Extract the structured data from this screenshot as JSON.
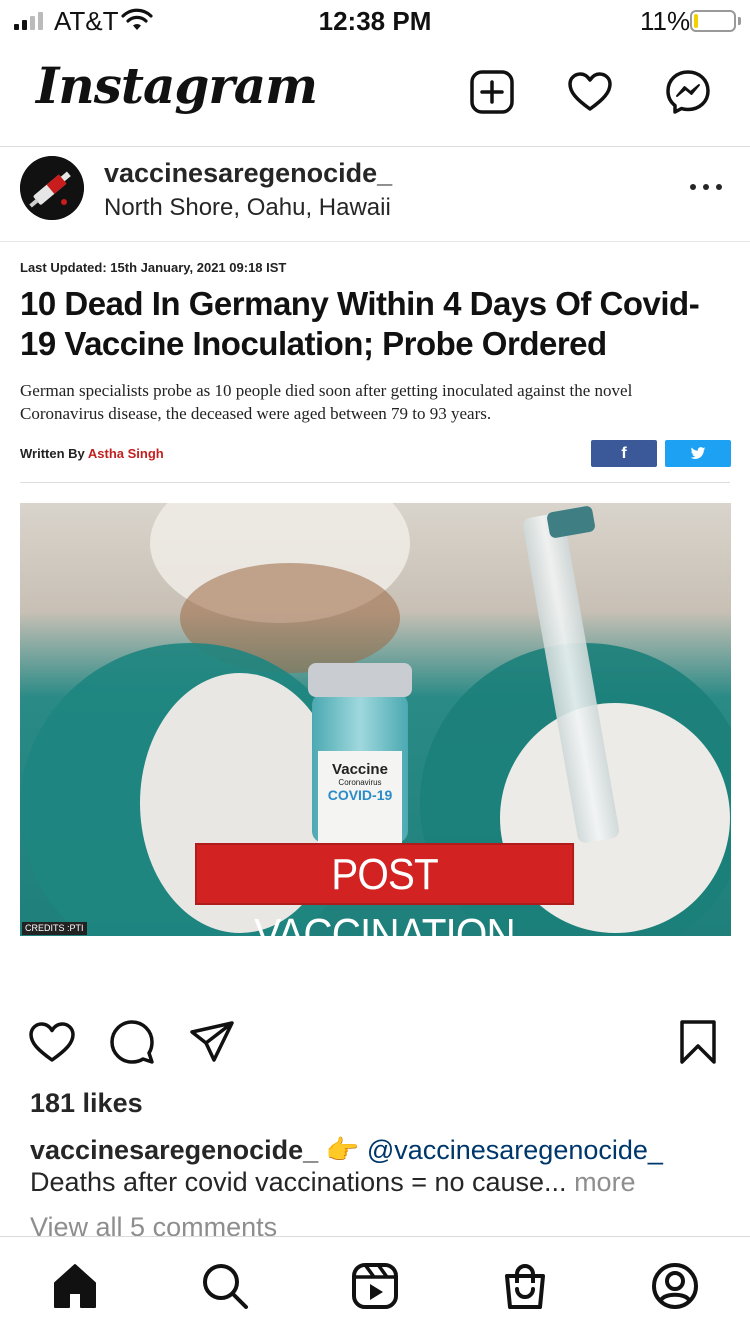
{
  "status_bar": {
    "carrier": "AT&T",
    "time": "12:38 PM",
    "battery_percent": "11%",
    "battery_level": 0.11,
    "signal_bars": 2
  },
  "header": {
    "logo_text": "Instagram",
    "icons": [
      "new-post-icon",
      "heart-icon",
      "messenger-icon"
    ]
  },
  "post": {
    "username": "vaccinesaregenocide_",
    "location": "North Shore, Oahu, Hawaii",
    "article": {
      "last_updated": "Last Updated: 15th January, 2021 09:18 IST",
      "headline": "10 Dead In Germany Within 4 Days Of Covid-19 Vaccine Inoculation; Probe Ordered",
      "summary": "German specialists probe as 10 people died soon after getting inoculated against the novel Coronavirus disease, the deceased were aged between 79 to 93 years.",
      "written_by_label": "Written By",
      "author": "Astha Singh",
      "share_facebook": "f",
      "image_overlay_text": "POST VACCINATION DEATH",
      "image_credits": "CREDITS :PTI",
      "vial_text_1": "Vaccine",
      "vial_text_2": "Coronavirus",
      "vial_text_3": "COVID-19"
    },
    "likes": "181 likes",
    "caption_user": "vaccinesaregenocide_",
    "caption_emoji": "👉",
    "caption_mention": "@vaccinesaregenocide_",
    "caption_text": "Deaths after covid vaccinations = no cause...",
    "caption_more": "more",
    "view_comments": "View all 5 comments"
  },
  "tab_bar": {
    "tabs": [
      "home-icon",
      "search-icon",
      "reels-icon",
      "shop-icon",
      "profile-icon"
    ]
  },
  "colors": {
    "author": "#c31f1f",
    "facebook": "#3b5998",
    "twitter": "#1da1f2",
    "overlay_red": "#d32222",
    "mention": "#00376b",
    "battery": "#f5d000"
  }
}
